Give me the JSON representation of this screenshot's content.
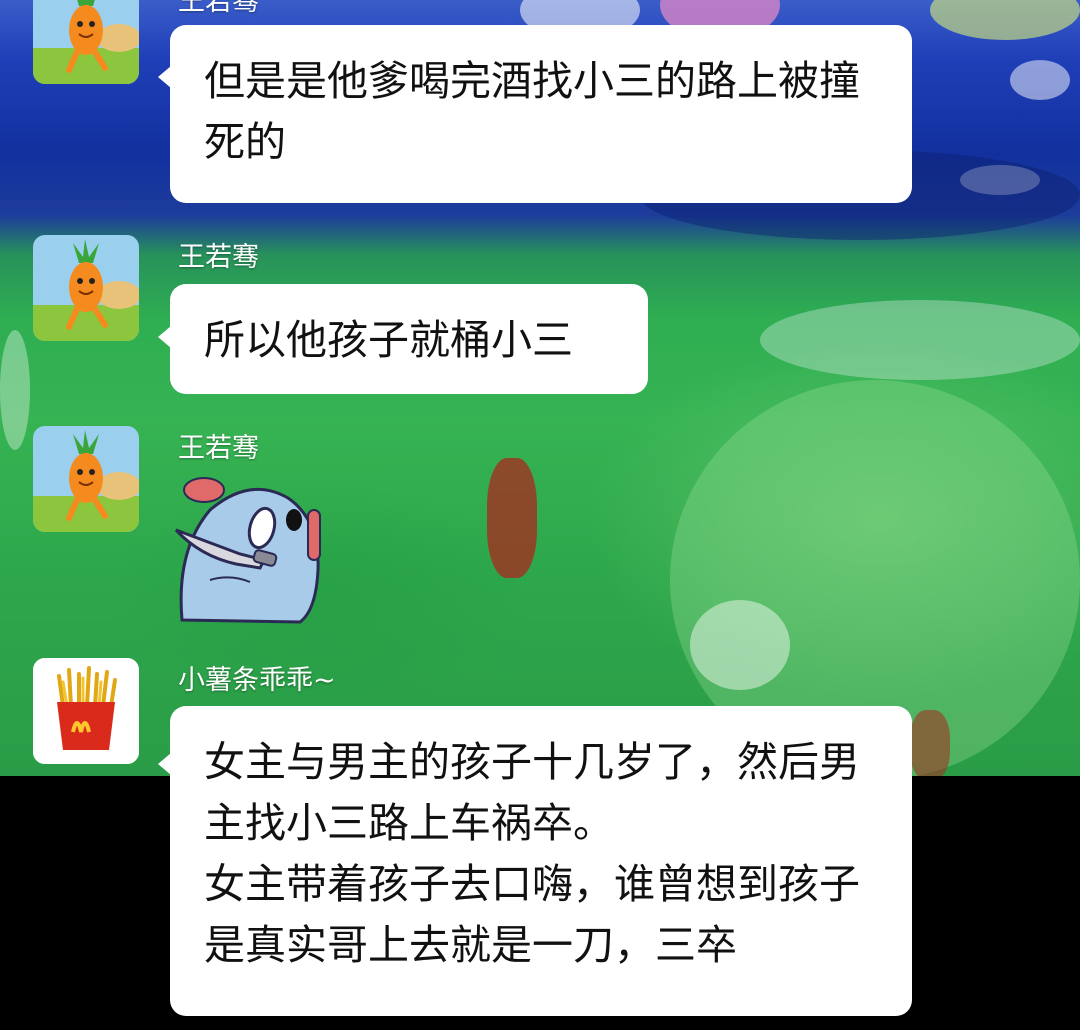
{
  "messages": [
    {
      "sender": "王若骞",
      "avatar": "carrot-avatar-icon",
      "type": "text",
      "text": "但是是他爹喝完酒找小三的路上被撞死的"
    },
    {
      "sender": "王若骞",
      "avatar": "carrot-avatar-icon",
      "type": "text",
      "text": "所以他孩子就桶小三"
    },
    {
      "sender": "王若骞",
      "avatar": "carrot-avatar-icon",
      "type": "sticker",
      "sticker": "blue-bird-knife-sticker-icon"
    },
    {
      "sender": "小薯条乖乖~",
      "avatar": "mcdonalds-fries-avatar-icon",
      "type": "text",
      "text": "女主与男主的孩子十几岁了，然后男主找小三路上车祸卒。\n女主带着孩子去口嗨，谁曾想到孩子是真实哥上去就是一刀，三卒"
    }
  ],
  "colors": {
    "bubble": "#ffffff",
    "name_text": "#ffffff",
    "message_text": "#111111",
    "wallpaper_blue": "#1f3fb8",
    "wallpaper_green": "#2fae52"
  }
}
